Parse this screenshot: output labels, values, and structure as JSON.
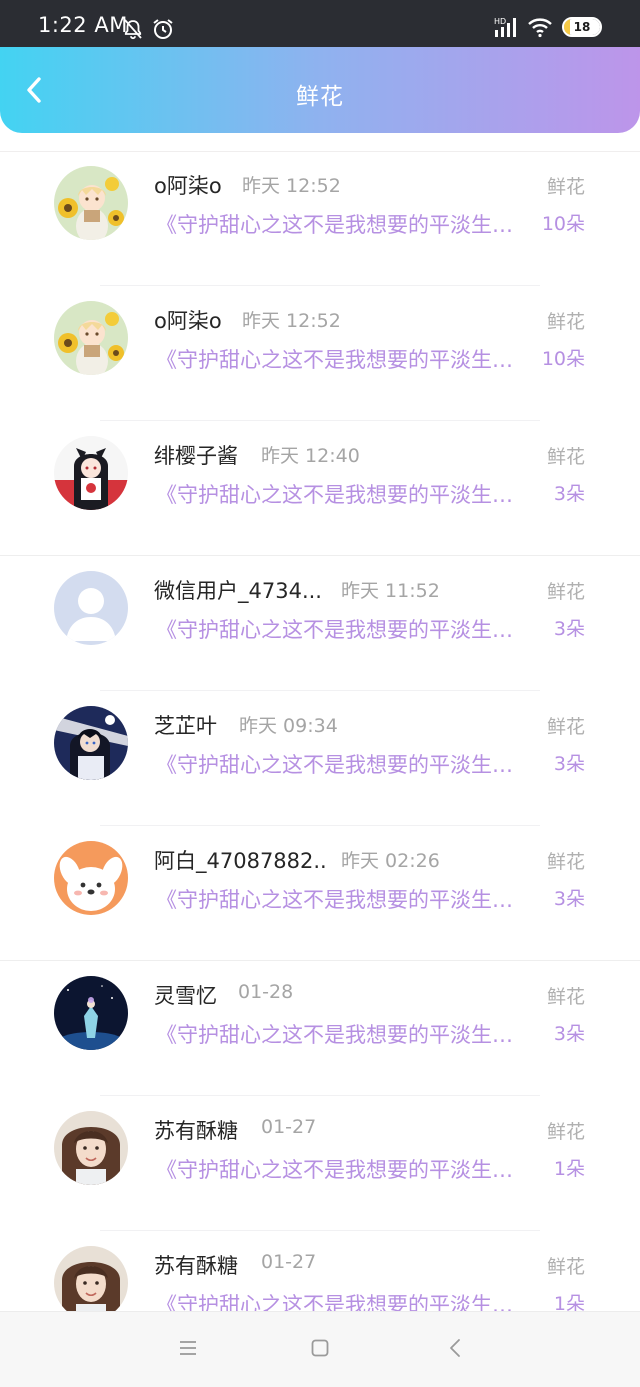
{
  "status_bar": {
    "time": "1:22 AM",
    "battery": "18",
    "battery_level": 0.18,
    "icons": [
      "mute-bell-icon",
      "alarm-icon",
      "hd-signal-icon",
      "wifi-icon",
      "battery-icon"
    ]
  },
  "header": {
    "title": "鲜花",
    "back_icon": "chevron-left-icon",
    "gradient_colors": [
      "#43d3f2",
      "#bd95ea"
    ]
  },
  "colors": {
    "accent": "#b690e2",
    "text_primary": "#262626",
    "text_secondary": "#a5a5a5"
  },
  "records": [
    {
      "name": "o阿柒o",
      "time": "昨天 12:52",
      "desc": "《守护甜心之这不是我想要的平淡生活》",
      "type": "鲜花",
      "count": "10朵",
      "avatar": "sunflower-girl-avatar"
    },
    {
      "name": "o阿柒o",
      "time": "昨天 12:52",
      "desc": "《守护甜心之这不是我想要的平淡生活》",
      "type": "鲜花",
      "count": "10朵",
      "avatar": "sunflower-girl-avatar"
    },
    {
      "name": "绯樱子酱",
      "time": "昨天 12:40",
      "desc": "《守护甜心之这不是我想要的平淡生活》",
      "type": "鲜花",
      "count": "3朵",
      "avatar": "anime-cat-girl-avatar"
    },
    {
      "name": "微信用户_4734...",
      "time": "昨天 11:52",
      "desc": "《守护甜心之这不是我想要的平淡生活》",
      "type": "鲜花",
      "count": "3朵",
      "avatar": "default-user-avatar"
    },
    {
      "name": "芝芷叶",
      "time": "昨天 09:34",
      "desc": "《守护甜心之这不是我想要的平淡生活》",
      "type": "鲜花",
      "count": "3朵",
      "avatar": "anime-boy-avatar"
    },
    {
      "name": "阿白_47087882...",
      "time": "昨天 02:26",
      "desc": "《守护甜心之这不是我想要的平淡生活》",
      "type": "鲜花",
      "count": "3朵",
      "avatar": "cartoon-dog-avatar"
    },
    {
      "name": "灵雪忆",
      "time": "01-28",
      "desc": "《守护甜心之这不是我想要的平淡生活》",
      "type": "鲜花",
      "count": "3朵",
      "avatar": "night-fairy-avatar"
    },
    {
      "name": "苏有酥糖",
      "time": "01-27",
      "desc": "《守护甜心之这不是我想要的平淡生活》",
      "type": "鲜花",
      "count": "1朵",
      "avatar": "girl-photo-avatar"
    },
    {
      "name": "苏有酥糖",
      "time": "01-27",
      "desc": "《守护甜心之这不是我想要的平淡生活》",
      "type": "鲜花",
      "count": "1朵",
      "avatar": "girl-photo-avatar"
    }
  ],
  "nav_bar": {
    "buttons": [
      "menu-icon",
      "home-square-icon",
      "back-triangle-icon"
    ]
  }
}
